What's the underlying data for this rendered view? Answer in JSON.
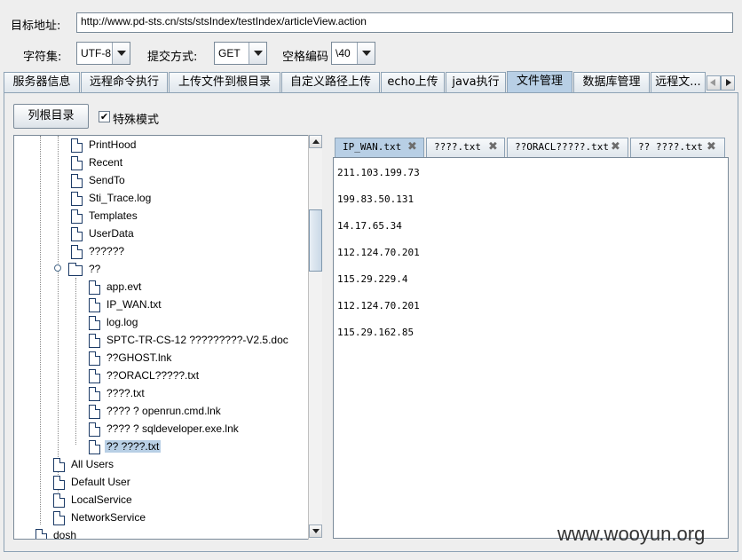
{
  "header": {
    "target_label": "目标地址:",
    "target_url": "http://www.pd-sts.cn/sts/stsIndex/testIndex/articleView.action",
    "charset_label": "字符集:",
    "charset_value": "UTF-8",
    "method_label": "提交方式:",
    "method_value": "GET",
    "space_label": "空格编码",
    "space_value": "\\40"
  },
  "tabs": [
    {
      "label": "服务器信息"
    },
    {
      "label": "远程命令执行"
    },
    {
      "label": "上传文件到根目录"
    },
    {
      "label": "自定义路径上传"
    },
    {
      "label": "echo上传"
    },
    {
      "label": "java执行"
    },
    {
      "label": "文件管理"
    },
    {
      "label": "数据库管理"
    },
    {
      "label": "远程文..."
    }
  ],
  "toolbar": {
    "list_root_label": "列根目录",
    "special_mode_label": "特殊模式",
    "special_mode_checked": "✔"
  },
  "tree": {
    "items": [
      "PrintHood",
      "Recent",
      "SendTo",
      "Sti_Trace.log",
      "Templates",
      "UserData",
      "??????",
      "??",
      "app.evt",
      "IP_WAN.txt",
      "log.log",
      "SPTC-TR-CS-12 ?????????-V2.5.doc",
      "??GHOST.lnk",
      "??ORACL?????.txt",
      "????.txt",
      "???? ? openrun.cmd.lnk",
      "???? ? sqldeveloper.exe.lnk",
      "?? ????.txt",
      "All Users",
      "Default User",
      "LocalService",
      "NetworkService",
      "dosh"
    ]
  },
  "file_tabs": [
    {
      "label": "IP_WAN.txt"
    },
    {
      "label": "????.txt"
    },
    {
      "label": "??ORACL?????.txt"
    },
    {
      "label": "?? ????.txt"
    }
  ],
  "editor": {
    "lines": [
      "211.103.199.73",
      "199.83.50.131",
      "14.17.65.34",
      "112.124.70.201",
      "115.29.229.4",
      "112.124.70.201",
      "115.29.162.85"
    ]
  },
  "watermark": "www.wooyun.org",
  "colors": {
    "active_tab": "#b8cfe5",
    "selection": "#b8cfe5"
  }
}
